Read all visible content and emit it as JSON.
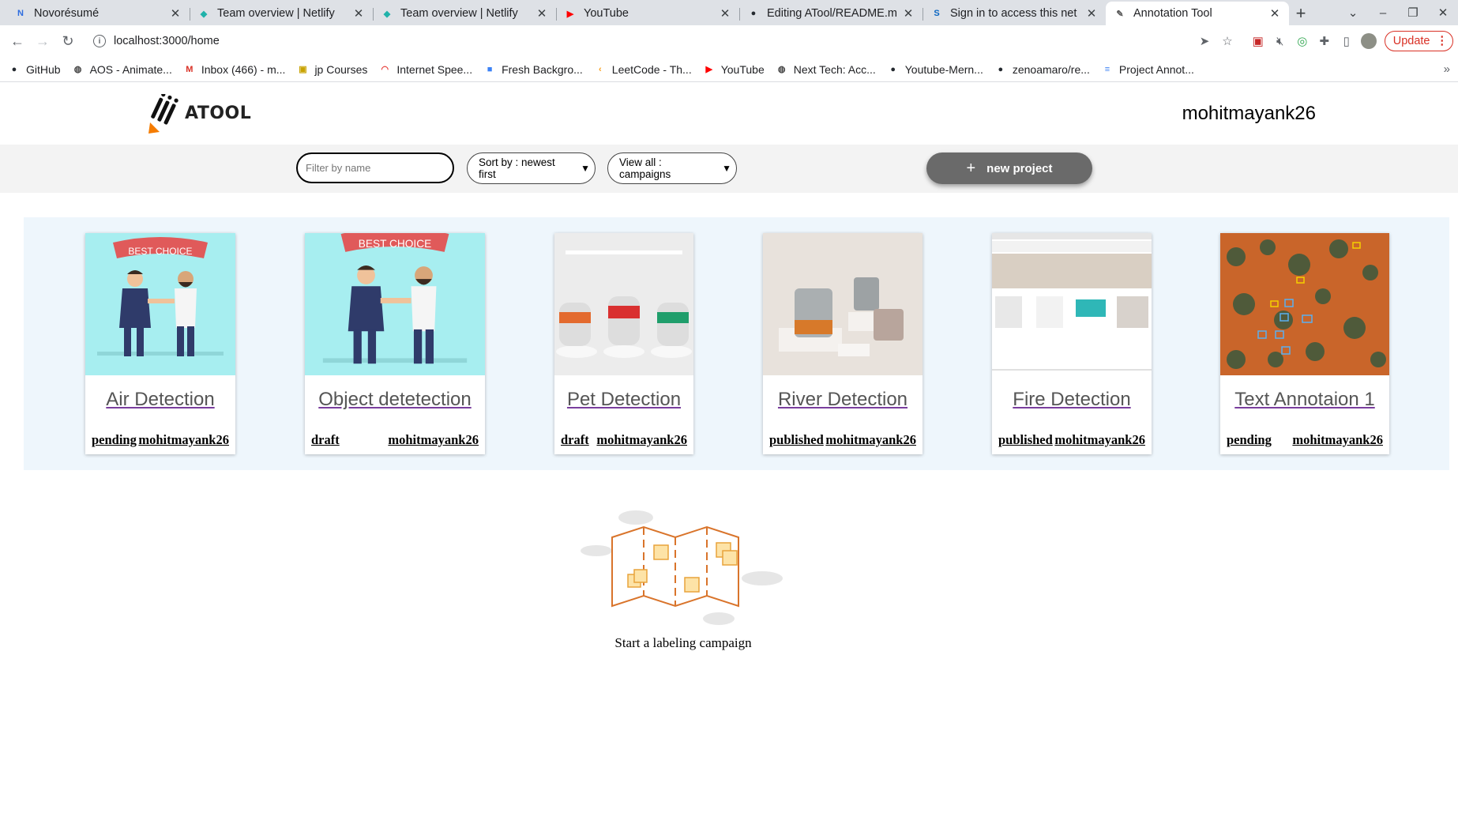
{
  "browser": {
    "tabs": [
      {
        "title": "Novorésumé",
        "favicon": "N",
        "color": "#2d6cdf",
        "active": false
      },
      {
        "title": "Team overview | Netlify",
        "favicon": "◆",
        "color": "#20b2aa",
        "active": false
      },
      {
        "title": "Team overview | Netlify",
        "favicon": "◆",
        "color": "#20b2aa",
        "active": false
      },
      {
        "title": "YouTube",
        "favicon": "▶",
        "color": "#ff0000",
        "active": false
      },
      {
        "title": "Editing ATool/README.m",
        "favicon": "●",
        "color": "#24292f",
        "active": false
      },
      {
        "title": "Sign in to access this net",
        "favicon": "S",
        "color": "#0a66c2",
        "active": false
      },
      {
        "title": "Annotation Tool",
        "favicon": "✎",
        "color": "#555555",
        "active": true
      }
    ],
    "url": "localhost:3000/home",
    "update_label": "Update",
    "bookmarks": [
      {
        "label": "GitHub",
        "icon": "github-icon",
        "glyph": "●",
        "color": "#24292f"
      },
      {
        "label": "AOS - Animate...",
        "icon": "globe-icon",
        "glyph": "◍",
        "color": "#444"
      },
      {
        "label": "Inbox (466) - m...",
        "icon": "gmail-icon",
        "glyph": "M",
        "color": "#d93025"
      },
      {
        "label": "jp Courses",
        "icon": "courses-icon",
        "glyph": "▣",
        "color": "#c8a200"
      },
      {
        "label": "Internet Spee...",
        "icon": "speedtest-icon",
        "glyph": "◠",
        "color": "#e53935"
      },
      {
        "label": "Fresh Backgro...",
        "icon": "cube-icon",
        "glyph": "■",
        "color": "#3b82f6"
      },
      {
        "label": "LeetCode - Th...",
        "icon": "leetcode-icon",
        "glyph": "‹",
        "color": "#f89f1b"
      },
      {
        "label": "YouTube",
        "icon": "youtube-icon",
        "glyph": "▶",
        "color": "#ff0000"
      },
      {
        "label": "Next Tech: Acc...",
        "icon": "globe-icon",
        "glyph": "◍",
        "color": "#444"
      },
      {
        "label": "Youtube-Mern...",
        "icon": "github-icon",
        "glyph": "●",
        "color": "#24292f"
      },
      {
        "label": "zenoamaro/re...",
        "icon": "github-icon",
        "glyph": "●",
        "color": "#24292f"
      },
      {
        "label": "Project Annot...",
        "icon": "docs-icon",
        "glyph": "≡",
        "color": "#4285f4"
      }
    ]
  },
  "app": {
    "logo_text": "ATOOL",
    "username": "mohitmayank26",
    "filter": {
      "placeholder": "Filter by name"
    },
    "sort_label": "Sort by : newest first",
    "view_label": "View all : campaigns",
    "new_project_label": "new project",
    "projects": [
      {
        "title": "Air Detection",
        "status": "pending",
        "owner": "mohitmayank26",
        "thumb": "handshake"
      },
      {
        "title": "Object detetection",
        "status": "draft",
        "owner": "mohitmayank26",
        "thumb": "handshake"
      },
      {
        "title": "Pet Detection",
        "status": "draft",
        "owner": "mohitmayank26",
        "thumb": "pods"
      },
      {
        "title": "River Detection",
        "status": "published",
        "owner": "mohitmayank26",
        "thumb": "products"
      },
      {
        "title": "Fire Detection",
        "status": "published",
        "owner": "mohitmayank26",
        "thumb": "screenshot"
      },
      {
        "title": "Text Annotaion 1",
        "status": "pending",
        "owner": "mohitmayank26",
        "thumb": "aerial"
      }
    ],
    "thumb_banner": "BEST CHOICE",
    "empty_label": "Start a labeling campaign"
  }
}
